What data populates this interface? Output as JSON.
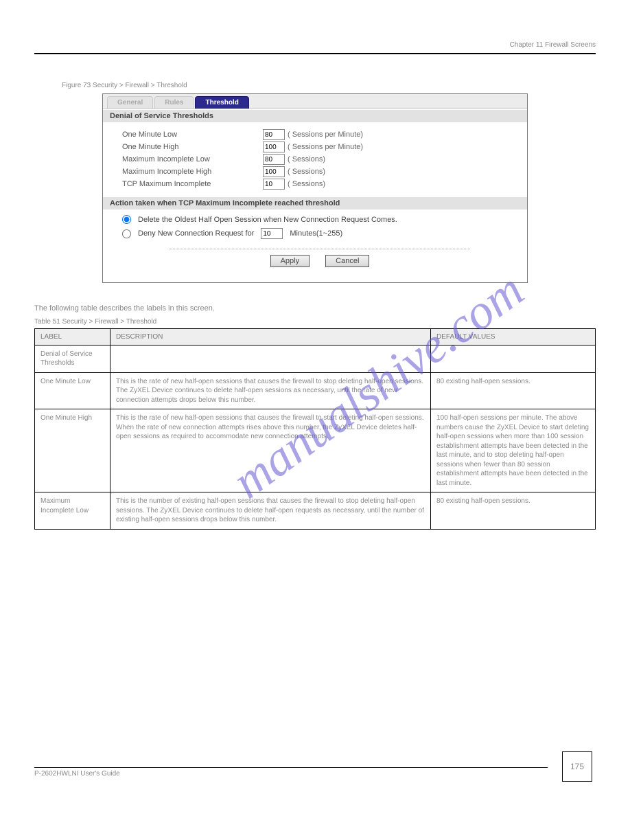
{
  "header": {
    "chapter": "Chapter 11 Firewall Screens"
  },
  "tabs": {
    "general": "General",
    "rules": "Rules",
    "threshold": "Threshold"
  },
  "section1": {
    "title": "Denial of Service Thresholds"
  },
  "fields": {
    "oneMinLow": {
      "label": "One Minute Low",
      "value": "80",
      "unit": "( Sessions per Minute)"
    },
    "oneMinHigh": {
      "label": "One Minute High",
      "value": "100",
      "unit": "( Sessions per Minute)"
    },
    "maxIncLow": {
      "label": "Maximum Incomplete Low",
      "value": "80",
      "unit": "( Sessions)"
    },
    "maxIncHigh": {
      "label": "Maximum Incomplete High",
      "value": "100",
      "unit": "( Sessions)"
    },
    "tcpMax": {
      "label": "TCP Maximum Incomplete",
      "value": "10",
      "unit": "( Sessions)"
    }
  },
  "section2": {
    "title": "Action taken when TCP Maximum Incomplete reached threshold"
  },
  "actions": {
    "deleteOldest": "Delete the Oldest Half Open Session when New Connection Request Comes.",
    "denyNewPre": "Deny New Connection Request for",
    "denyValue": "10",
    "denyNewPost": "Minutes(1~255)"
  },
  "buttons": {
    "apply": "Apply",
    "cancel": "Cancel"
  },
  "figureCaption": "Figure 73   Security > Firewall > Threshold",
  "tableCaption": "Table 51   Security > Firewall > Threshold",
  "tableNote": "The following table describes the labels in this screen.",
  "tableHeaders": {
    "c1": "LABEL",
    "c2": "DESCRIPTION",
    "c3": "DEFAULT VALUES"
  },
  "rows": [
    {
      "c1": "Denial of Service Thresholds",
      "c2": "",
      "c3": ""
    },
    {
      "c1": "One Minute Low",
      "c2": "This is the rate of new half-open sessions that causes the firewall to stop deleting half-open sessions. The ZyXEL Device continues to delete half-open sessions as necessary, until the rate of new connection attempts drops below this number.",
      "c3": "80 existing half-open sessions."
    },
    {
      "c1": "One Minute High",
      "c2": "This is the rate of new half-open sessions that causes the firewall to start deleting half-open sessions. When the rate of new connection attempts rises above this number, the ZyXEL Device deletes half-open sessions as required to accommodate new connection attempts.",
      "c3": "100 half-open sessions per minute. The above numbers cause the ZyXEL Device to start deleting half-open sessions when more than 100 session establishment attempts have been detected in the last minute, and to stop deleting half-open sessions when fewer than 80 session establishment attempts have been detected in the last minute."
    },
    {
      "c1": "Maximum Incomplete Low",
      "c2": "This is the number of existing half-open sessions that causes the firewall to stop deleting half-open sessions. The ZyXEL Device continues to delete half-open requests as necessary, until the number of existing half-open sessions drops below this number.",
      "c3": "80 existing half-open sessions."
    }
  ],
  "footer": "P-2602HWLNI User's Guide",
  "pageNumber": "175",
  "watermark": "manualshive.com"
}
